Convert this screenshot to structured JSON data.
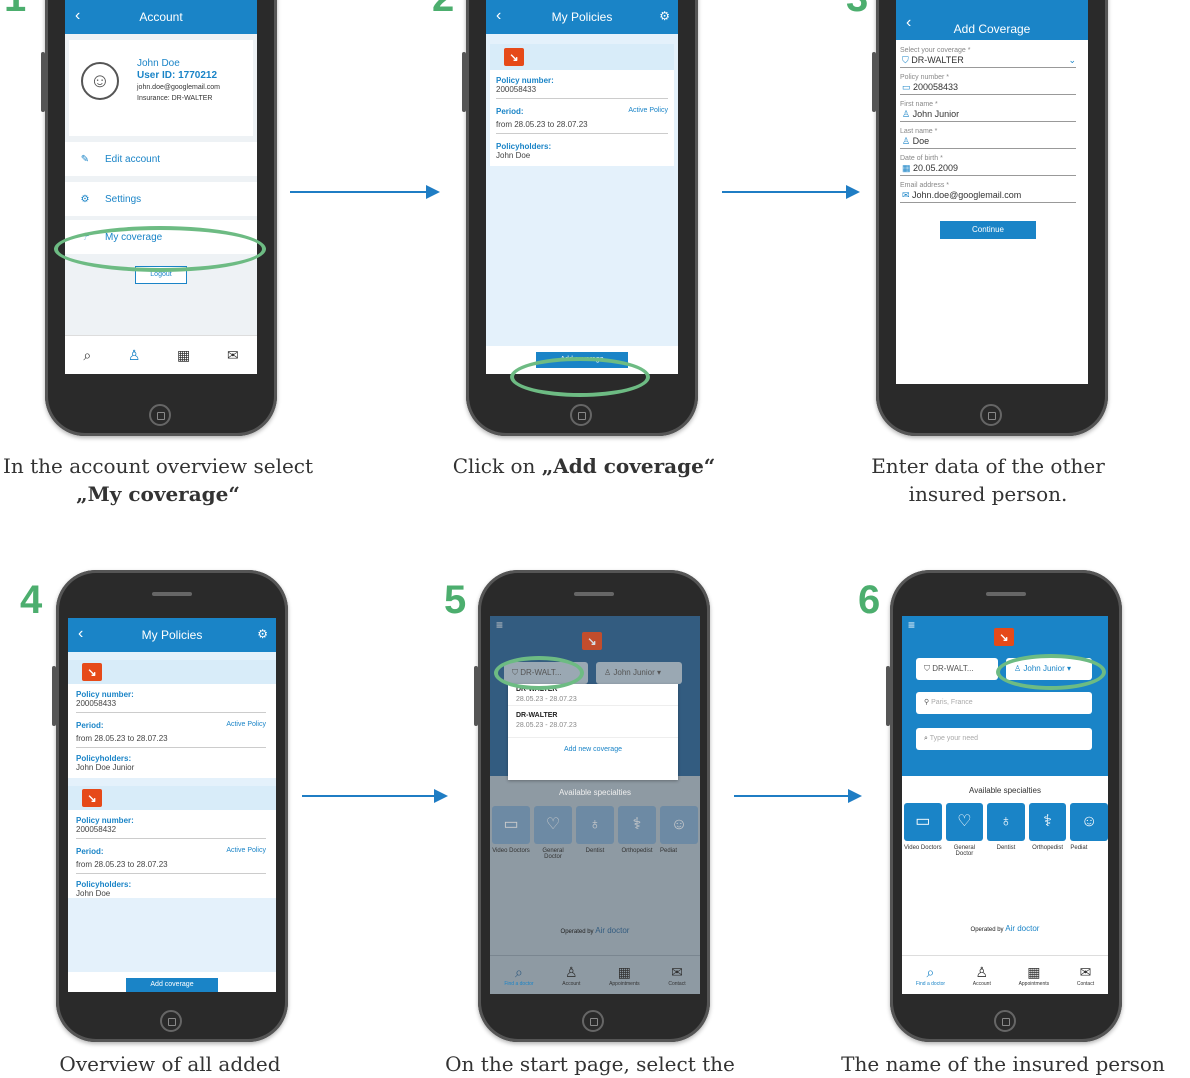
{
  "steps": [
    {
      "num": "1",
      "caption_pre": "In the account overview select ",
      "caption_bold": "„My coverage“",
      "caption_post": ""
    },
    {
      "num": "2",
      "caption_pre": "Click on ",
      "caption_bold": "„Add coverage“",
      "caption_post": ""
    },
    {
      "num": "3",
      "caption_pre": "Enter data of the other insured person.",
      "caption_bold": "",
      "caption_post": ""
    },
    {
      "num": "4",
      "caption_pre": "Overview of all added",
      "caption_bold": "",
      "caption_post": ""
    },
    {
      "num": "5",
      "caption_pre": "On the start page, select the",
      "caption_bold": "",
      "caption_post": ""
    },
    {
      "num": "6",
      "caption_pre": "The name of the insured person",
      "caption_bold": "",
      "caption_post": ""
    }
  ],
  "account": {
    "title": "Account",
    "name": "John Doe",
    "user_id": "User ID: 1770212",
    "email": "john.doe@googlemail.com",
    "insurance": "Insurance: DR-WALTER",
    "menu": [
      {
        "label": "Edit account",
        "icon": "edit-icon"
      },
      {
        "label": "Settings",
        "icon": "gear-icon"
      },
      {
        "label": "My coverage",
        "icon": "umbrella-icon"
      }
    ],
    "logout": "Logout"
  },
  "policies": {
    "title": "My Policies",
    "policy_number_label": "Policy number:",
    "period_label": "Period:",
    "active_label": "Active Policy",
    "holders_label": "Policyholders:",
    "period_value": "from 28.05.23 to 28.07.23",
    "items": [
      {
        "number": "200058433",
        "holders": "John Doe"
      },
      {
        "number": "200058433",
        "holders": "John Doe Junior"
      },
      {
        "number": "200058432",
        "holders": "John Doe"
      }
    ],
    "add_button": "Add coverage"
  },
  "add_coverage": {
    "title": "Add Coverage",
    "fields": [
      {
        "label": "Select your coverage *",
        "value": "DR-WALTER"
      },
      {
        "label": "Policy number *",
        "value": "200058433"
      },
      {
        "label": "First name *",
        "value": "John Junior"
      },
      {
        "label": "Last name *",
        "value": "Doe"
      },
      {
        "label": "Date of birth *",
        "value": "20.05.2009"
      },
      {
        "label": "Email address *",
        "value": "John.doe@googlemail.com"
      }
    ],
    "continue": "Continue"
  },
  "home": {
    "coverage_short": "DR-WALT...",
    "person": "John Junior",
    "dropdown": [
      {
        "name": "DR-WALTER",
        "dates": "28.05.23 - 28.07.23"
      },
      {
        "name": "DR-WALTER",
        "dates": "28.05.23 - 28.07.23"
      }
    ],
    "add_new": "Add new coverage",
    "location_placeholder": "Paris, France",
    "need_placeholder": "Type your need",
    "specialties_title": "Available specialties",
    "specialties": [
      "Video Doctors",
      "General Doctor",
      "Dentist",
      "Orthopedist",
      "Pediat"
    ],
    "operated_by": "Operated by",
    "brand": "Air doctor",
    "tabs": [
      "Find a doctor",
      "Account",
      "Appointments",
      "Contact"
    ]
  },
  "colors": {
    "accent": "#1a84c7",
    "highlight": "#6dbb83",
    "step_num": "#4cae6e",
    "logo": "#e64a19"
  }
}
